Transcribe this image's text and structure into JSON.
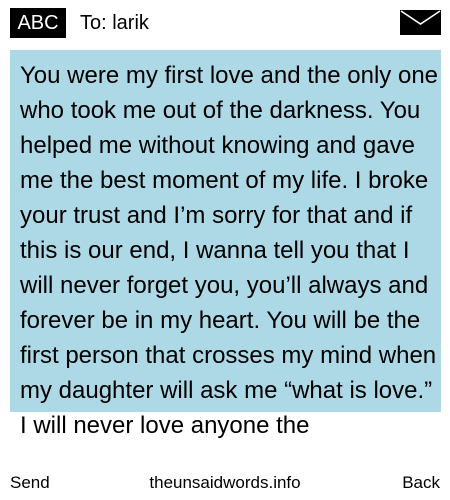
{
  "header": {
    "input_mode": "ABC",
    "recipient": "To: larik",
    "envelope_icon": "envelope-icon"
  },
  "message": {
    "body": "You were my first love and the only one who took me out of the darkness. You helped me without knowing and gave me the best moment of my life. I broke your trust and I’m sorry for that and if this is our end, I wanna tell you that I will never forget you, you’ll always and forever be in my heart. You will be the first person that crosses my mind when my daughter will ask me “what is love.” I will never love anyone the",
    "highlight_color": "#add8e6"
  },
  "softkeys": {
    "left": "Send",
    "center": "theunsaidwords.info",
    "right": "Back"
  }
}
